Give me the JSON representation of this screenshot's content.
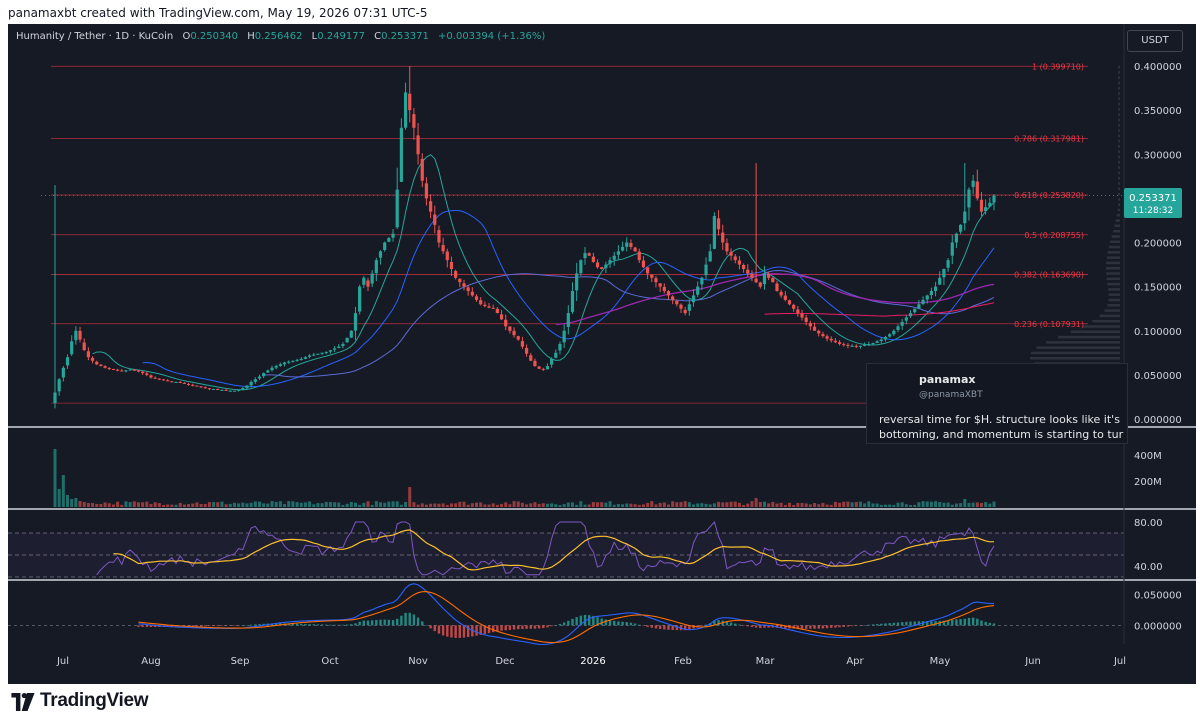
{
  "credit": "panamaxbt created with TradingView.com, May 19, 2026 07:31 UTC-5",
  "legend": {
    "symbol": "Humanity / Tether · 1D · KuCoin",
    "open_label": "O",
    "open": "0.250340",
    "high_label": "H",
    "high": "0.256462",
    "low_label": "L",
    "low": "0.249177",
    "close_label": "C",
    "close": "0.253371",
    "change": "+0.003394 (+1.36%)"
  },
  "currency": "USDT",
  "price_badge": {
    "price": "0.253371",
    "countdown": "11:28:32"
  },
  "tweet": {
    "name": "panamax",
    "handle": "@panamaXBT",
    "line1": "reversal time for $H. structure looks like it's",
    "line2": "bottoming, and momentum is starting to tur"
  },
  "footer": {
    "brand": "TradingView"
  },
  "colors": {
    "background": "#161a25",
    "up": "#26a69a",
    "down": "#ef5350",
    "fib": "#f23645",
    "rsi": "#7e57c2",
    "rsi_ma": "#fbc02d",
    "macd": "#2962ff",
    "signal": "#ff6d00",
    "ma_blue": "#2962ff",
    "ma_purple": "#9c27b0",
    "ma_green": "#26a69a"
  },
  "chart_data": [
    {
      "type": "candlestick",
      "title": "Humanity / Tether · 1D · KuCoin",
      "ylim": [
        0,
        0.4
      ],
      "y_ticks": [
        "0.400000",
        "0.350000",
        "0.300000",
        "0.250000",
        "0.200000",
        "0.150000",
        "0.100000",
        "0.050000",
        "0.000000"
      ],
      "x_ticks": [
        "Jul",
        "Aug",
        "Sep",
        "Oct",
        "Nov",
        "Dec",
        "2026",
        "Feb",
        "Mar",
        "Apr",
        "May",
        "Jun",
        "Jul"
      ],
      "x_start": "2025-06-26",
      "close_series": [
        0.03,
        0.045,
        0.058,
        0.07,
        0.088,
        0.1,
        0.09,
        0.078,
        0.07,
        0.066,
        0.062,
        0.06,
        0.058,
        0.057,
        0.056,
        0.055,
        0.054,
        0.055,
        0.056,
        0.055,
        0.054,
        0.052,
        0.05,
        0.047,
        0.046,
        0.045,
        0.044,
        0.043,
        0.042,
        0.042,
        0.041,
        0.04,
        0.039,
        0.038,
        0.037,
        0.036,
        0.035,
        0.034,
        0.034,
        0.033,
        0.033,
        0.032,
        0.032,
        0.032,
        0.033,
        0.035,
        0.038,
        0.042,
        0.045,
        0.048,
        0.052,
        0.055,
        0.058,
        0.06,
        0.062,
        0.064,
        0.065,
        0.066,
        0.067,
        0.068,
        0.07,
        0.072,
        0.073,
        0.074,
        0.075,
        0.076,
        0.078,
        0.08,
        0.082,
        0.085,
        0.092,
        0.1,
        0.12,
        0.15,
        0.16,
        0.15,
        0.165,
        0.18,
        0.19,
        0.2,
        0.205,
        0.21,
        0.26,
        0.33,
        0.37,
        0.35,
        0.33,
        0.3,
        0.27,
        0.25,
        0.235,
        0.22,
        0.2,
        0.19,
        0.18,
        0.17,
        0.16,
        0.155,
        0.15,
        0.145,
        0.14,
        0.135,
        0.13,
        0.128,
        0.126,
        0.125,
        0.12,
        0.113,
        0.105,
        0.1,
        0.095,
        0.09,
        0.082,
        0.074,
        0.066,
        0.06,
        0.057,
        0.056,
        0.06,
        0.068,
        0.075,
        0.085,
        0.1,
        0.12,
        0.145,
        0.165,
        0.18,
        0.188,
        0.185,
        0.178,
        0.172,
        0.17,
        0.175,
        0.18,
        0.185,
        0.19,
        0.195,
        0.2,
        0.195,
        0.19,
        0.18,
        0.172,
        0.165,
        0.16,
        0.155,
        0.15,
        0.145,
        0.14,
        0.135,
        0.13,
        0.125,
        0.12,
        0.13,
        0.14,
        0.15,
        0.16,
        0.175,
        0.19,
        0.23,
        0.215,
        0.2,
        0.19,
        0.185,
        0.18,
        0.175,
        0.17,
        0.165,
        0.16,
        0.155,
        0.15,
        0.165,
        0.16,
        0.155,
        0.145,
        0.14,
        0.135,
        0.13,
        0.125,
        0.12,
        0.115,
        0.11,
        0.105,
        0.1,
        0.097,
        0.094,
        0.091,
        0.089,
        0.087,
        0.085,
        0.084,
        0.083,
        0.083,
        0.082,
        0.083,
        0.084,
        0.085,
        0.086,
        0.088,
        0.09,
        0.093,
        0.096,
        0.1,
        0.105,
        0.11,
        0.115,
        0.12,
        0.125,
        0.13,
        0.135,
        0.14,
        0.145,
        0.15,
        0.16,
        0.17,
        0.18,
        0.2,
        0.21,
        0.22,
        0.235,
        0.26,
        0.27,
        0.25,
        0.235,
        0.24,
        0.245,
        0.253
      ],
      "fib_levels": [
        {
          "label": "1 (0.399710)",
          "value": 0.39971
        },
        {
          "label": "0.786 (0.317981)",
          "value": 0.317981
        },
        {
          "label": "0.618 (0.253820)",
          "value": 0.25382
        },
        {
          "label": "0.5 (0.208755)",
          "value": 0.208755
        },
        {
          "label": "0.382 (0.163690)",
          "value": 0.16369
        },
        {
          "label": "0.236 (0.107931)",
          "value": 0.107931
        }
      ]
    },
    {
      "type": "bar",
      "title": "Volume",
      "y_ticks": [
        "400M",
        "200M"
      ],
      "ylim": [
        0,
        400000000
      ]
    },
    {
      "type": "line",
      "title": "RSI",
      "y_ticks": [
        "80.00",
        "40.00"
      ],
      "ylim": [
        30,
        90
      ],
      "bands": [
        70,
        50,
        30
      ]
    },
    {
      "type": "line",
      "title": "MACD",
      "y_ticks": [
        "0.050000",
        "0.000000"
      ],
      "ylim": [
        -0.03,
        0.07
      ]
    }
  ]
}
